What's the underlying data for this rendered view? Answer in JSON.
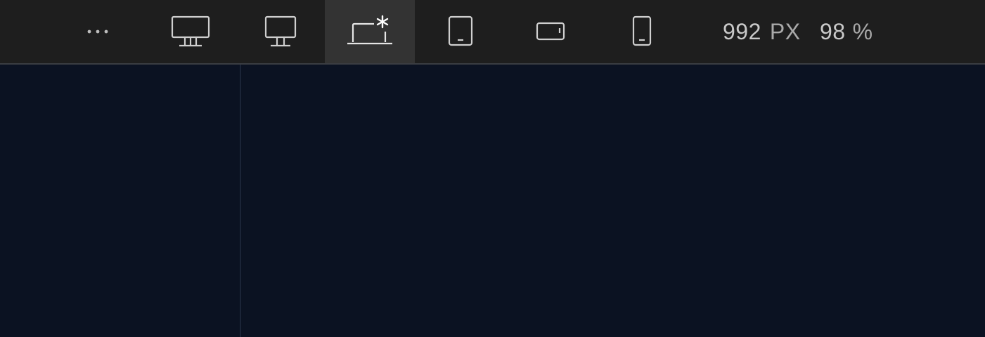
{
  "toolbar": {
    "more_icon": "more-horizontal-icon",
    "devices": [
      {
        "id": "desktop-large",
        "icon": "desktop-large-icon",
        "active": false
      },
      {
        "id": "desktop",
        "icon": "desktop-icon",
        "active": false
      },
      {
        "id": "laptop-base",
        "icon": "laptop-asterisk-icon",
        "active": true
      },
      {
        "id": "tablet-portrait",
        "icon": "tablet-portrait-icon",
        "active": false
      },
      {
        "id": "mobile-landscape",
        "icon": "mobile-landscape-icon",
        "active": false
      },
      {
        "id": "mobile-portrait",
        "icon": "mobile-portrait-icon",
        "active": false
      }
    ],
    "width_value": "992",
    "width_unit": "PX",
    "zoom_value": "98",
    "zoom_unit": "%"
  },
  "colors": {
    "toolbar_bg": "#1e1e1e",
    "active_bg": "#333333",
    "canvas_bg": "#0b1222",
    "icon": "#cfcfcf"
  }
}
